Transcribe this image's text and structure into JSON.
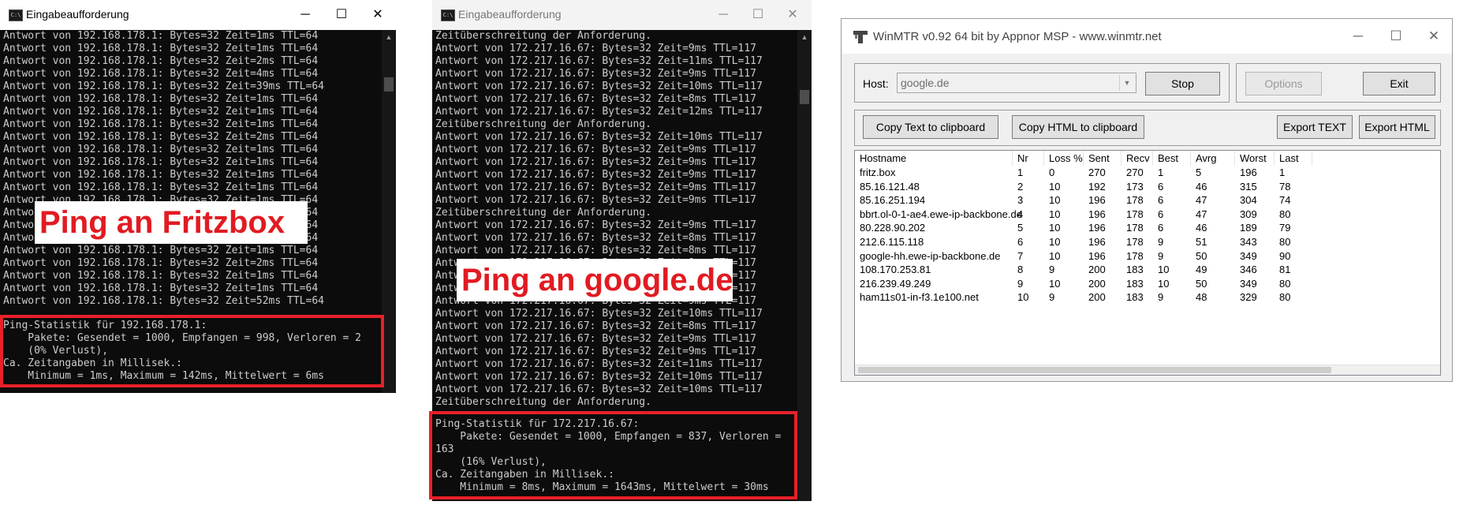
{
  "cmd_left": {
    "title": "Eingabeaufforderung",
    "controls": {
      "minimize": "─",
      "maximize": "☐",
      "close": "✕"
    },
    "lines": [
      "Antwort von 192.168.178.1: Bytes=32 Zeit=1ms TTL=64",
      "Antwort von 192.168.178.1: Bytes=32 Zeit=1ms TTL=64",
      "Antwort von 192.168.178.1: Bytes=32 Zeit=2ms TTL=64",
      "Antwort von 192.168.178.1: Bytes=32 Zeit=4ms TTL=64",
      "Antwort von 192.168.178.1: Bytes=32 Zeit=39ms TTL=64",
      "Antwort von 192.168.178.1: Bytes=32 Zeit=1ms TTL=64",
      "Antwort von 192.168.178.1: Bytes=32 Zeit=1ms TTL=64",
      "Antwort von 192.168.178.1: Bytes=32 Zeit=1ms TTL=64",
      "Antwort von 192.168.178.1: Bytes=32 Zeit=2ms TTL=64",
      "Antwort von 192.168.178.1: Bytes=32 Zeit=1ms TTL=64",
      "Antwort von 192.168.178.1: Bytes=32 Zeit=1ms TTL=64",
      "Antwort von 192.168.178.1: Bytes=32 Zeit=1ms TTL=64",
      "Antwort von 192.168.178.1: Bytes=32 Zeit=1ms TTL=64",
      "Antwort von 192.168.178.1: Bytes=32 Zeit=1ms TTL=64",
      "Antwort von 192.168.178.1: Bytes=32 Zeit=1ms TTL=64",
      "Antwort von 192.168.178.1: Bytes=32 Zeit=1ms TTL=64",
      "Antwort von 192.168.178.1: Bytes=32 Zeit=1ms TTL=64",
      "Antwort von 192.168.178.1: Bytes=32 Zeit=1ms TTL=64",
      "Antwort von 192.168.178.1: Bytes=32 Zeit=2ms TTL=64",
      "Antwort von 192.168.178.1: Bytes=32 Zeit=1ms TTL=64",
      "Antwort von 192.168.178.1: Bytes=32 Zeit=1ms TTL=64",
      "Antwort von 192.168.178.1: Bytes=32 Zeit=52ms TTL=64"
    ],
    "stats": [
      "Ping-Statistik für 192.168.178.1:",
      "    Pakete: Gesendet = 1000, Empfangen = 998, Verloren = 2",
      "    (0% Verlust),",
      "Ca. Zeitangaben in Millisek.:",
      "    Minimum = 1ms, Maximum = 142ms, Mittelwert = 6ms"
    ],
    "overlay_label": "Ping an Fritzbox"
  },
  "cmd_middle": {
    "title": "Eingabeaufforderung",
    "controls": {
      "minimize": "─",
      "maximize": "☐",
      "close": "✕"
    },
    "lines": [
      "Zeitüberschreitung der Anforderung.",
      "Antwort von 172.217.16.67: Bytes=32 Zeit=9ms TTL=117",
      "Antwort von 172.217.16.67: Bytes=32 Zeit=11ms TTL=117",
      "Antwort von 172.217.16.67: Bytes=32 Zeit=9ms TTL=117",
      "Antwort von 172.217.16.67: Bytes=32 Zeit=10ms TTL=117",
      "Antwort von 172.217.16.67: Bytes=32 Zeit=8ms TTL=117",
      "Antwort von 172.217.16.67: Bytes=32 Zeit=12ms TTL=117",
      "Zeitüberschreitung der Anforderung.",
      "Antwort von 172.217.16.67: Bytes=32 Zeit=10ms TTL=117",
      "Antwort von 172.217.16.67: Bytes=32 Zeit=9ms TTL=117",
      "Antwort von 172.217.16.67: Bytes=32 Zeit=9ms TTL=117",
      "Antwort von 172.217.16.67: Bytes=32 Zeit=9ms TTL=117",
      "Antwort von 172.217.16.67: Bytes=32 Zeit=9ms TTL=117",
      "Antwort von 172.217.16.67: Bytes=32 Zeit=9ms TTL=117",
      "Zeitüberschreitung der Anforderung.",
      "Antwort von 172.217.16.67: Bytes=32 Zeit=9ms TTL=117",
      "Antwort von 172.217.16.67: Bytes=32 Zeit=8ms TTL=117",
      "Antwort von 172.217.16.67: Bytes=32 Zeit=8ms TTL=117",
      "Antwort von 172.217.16.67: Bytes=32 Zeit=9ms TTL=117",
      "Antwort von 172.217.16.67: Bytes=32 Zeit=9ms TTL=117",
      "Antwort von 172.217.16.67: Bytes=32 Zeit=9ms TTL=117",
      "Antwort von 172.217.16.67: Bytes=32 Zeit=9ms TTL=117",
      "Antwort von 172.217.16.67: Bytes=32 Zeit=10ms TTL=117",
      "Antwort von 172.217.16.67: Bytes=32 Zeit=8ms TTL=117",
      "Antwort von 172.217.16.67: Bytes=32 Zeit=9ms TTL=117",
      "Antwort von 172.217.16.67: Bytes=32 Zeit=9ms TTL=117",
      "Antwort von 172.217.16.67: Bytes=32 Zeit=11ms TTL=117",
      "Antwort von 172.217.16.67: Bytes=32 Zeit=10ms TTL=117",
      "Antwort von 172.217.16.67: Bytes=32 Zeit=10ms TTL=117",
      "Zeitüberschreitung der Anforderung."
    ],
    "stats": [
      "Ping-Statistik für 172.217.16.67:",
      "    Pakete: Gesendet = 1000, Empfangen = 837, Verloren =",
      "163",
      "    (16% Verlust),",
      "Ca. Zeitangaben in Millisek.:",
      "    Minimum = 8ms, Maximum = 1643ms, Mittelwert = 30ms"
    ],
    "overlay_label": "Ping an google.de"
  },
  "winmtr": {
    "title": "WinMTR v0.92 64 bit by Appnor MSP - www.winmtr.net",
    "controls": {
      "minimize": "─",
      "maximize": "☐",
      "close": "✕"
    },
    "host_label": "Host:",
    "host_value": "google.de",
    "buttons": {
      "stop": "Stop",
      "options": "Options",
      "exit": "Exit",
      "copy_text": "Copy Text to clipboard",
      "copy_html": "Copy HTML to clipboard",
      "export_text": "Export TEXT",
      "export_html": "Export HTML"
    },
    "columns": [
      "Hostname",
      "Nr",
      "Loss %",
      "Sent",
      "Recv",
      "Best",
      "Avrg",
      "Worst",
      "Last"
    ],
    "rows": [
      [
        "fritz.box",
        "1",
        "0",
        "270",
        "270",
        "1",
        "5",
        "196",
        "1"
      ],
      [
        "85.16.121.48",
        "2",
        "10",
        "192",
        "173",
        "6",
        "46",
        "315",
        "78"
      ],
      [
        "85.16.251.194",
        "3",
        "10",
        "196",
        "178",
        "6",
        "47",
        "304",
        "74"
      ],
      [
        "bbrt.ol-0-1-ae4.ewe-ip-backbone.de",
        "4",
        "10",
        "196",
        "178",
        "6",
        "47",
        "309",
        "80"
      ],
      [
        "80.228.90.202",
        "5",
        "10",
        "196",
        "178",
        "6",
        "46",
        "189",
        "79"
      ],
      [
        "212.6.115.118",
        "6",
        "10",
        "196",
        "178",
        "9",
        "51",
        "343",
        "80"
      ],
      [
        "google-hh.ewe-ip-backbone.de",
        "7",
        "10",
        "196",
        "178",
        "9",
        "50",
        "349",
        "90"
      ],
      [
        "108.170.253.81",
        "8",
        "9",
        "200",
        "183",
        "10",
        "49",
        "346",
        "81"
      ],
      [
        "216.239.49.249",
        "9",
        "10",
        "200",
        "183",
        "10",
        "50",
        "349",
        "80"
      ],
      [
        "ham11s01-in-f3.1e100.net",
        "10",
        "9",
        "200",
        "183",
        "9",
        "48",
        "329",
        "80"
      ]
    ]
  }
}
